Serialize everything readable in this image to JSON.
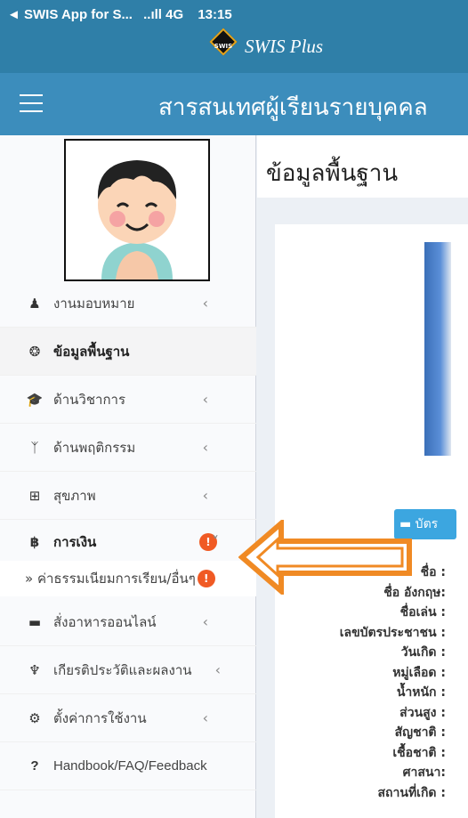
{
  "status_bar": {
    "back_app": "◄ SWIS App for S...",
    "signal": "..ıll 4G",
    "time": "13:15"
  },
  "brand": {
    "logo_text": "SWIS",
    "name": "SWIS Plus"
  },
  "header": {
    "title": "สารสนเทศผู้เรียนรายบุคคล"
  },
  "sidebar": {
    "items": [
      {
        "icon": "user-icon",
        "glyph": "♟",
        "label": "งานมอบหมาย",
        "chevron": "‹"
      },
      {
        "icon": "dashboard-icon",
        "glyph": "❂",
        "label": "ข้อมูลพื้นฐาน",
        "chevron": ""
      },
      {
        "icon": "graduation-cap-icon",
        "glyph": "🎓",
        "label": "ด้านวิชาการ",
        "chevron": "‹"
      },
      {
        "icon": "child-icon",
        "glyph": "ᛉ",
        "label": "ด้านพฤติกรรม",
        "chevron": "‹"
      },
      {
        "icon": "medkit-icon",
        "glyph": "⊞",
        "label": "สุขภาพ",
        "chevron": "‹"
      },
      {
        "icon": "baht-icon",
        "glyph": "฿",
        "label": "การเงิน",
        "chevron": "˅",
        "badge": "!"
      },
      {
        "icon": "food-icon",
        "glyph": "▬",
        "label": "สั่งอาหารออนไลน์",
        "chevron": "‹"
      },
      {
        "icon": "trophy-icon",
        "glyph": "♆",
        "label": "เกียรติประวัติและผลงาน",
        "chevron": "‹"
      },
      {
        "icon": "gear-icon",
        "glyph": "⚙",
        "label": "ตั้งค่าการใช้งาน",
        "chevron": "‹"
      },
      {
        "icon": "question-icon",
        "glyph": "?",
        "label": "Handbook/FAQ/Feedback",
        "chevron": ""
      }
    ],
    "sub_item": {
      "label": "» ค่าธรรมเนียมการเรียน/อื่นๆ",
      "badge": "!"
    }
  },
  "content": {
    "heading": "ข้อมูลพื้นฐาน",
    "id_button": "▬ บัตร",
    "fields": [
      "ชื่อ :",
      "ชื่อ อังกฤษ:",
      "ชื่อเล่น :",
      "เลขบัตรประชาชน :",
      "วันเกิด :",
      "หมู่เลือด :",
      "น้ำหนัก :",
      "ส่วนสูง :",
      "สัญชาติ :",
      "เชื้อชาติ :",
      "ศาสนา:",
      "สถานที่เกิด :"
    ]
  },
  "colors": {
    "header": "#3c8dbc",
    "status": "#2f7fa8",
    "badge": "#f05a24",
    "arrow": "#f08a24"
  }
}
